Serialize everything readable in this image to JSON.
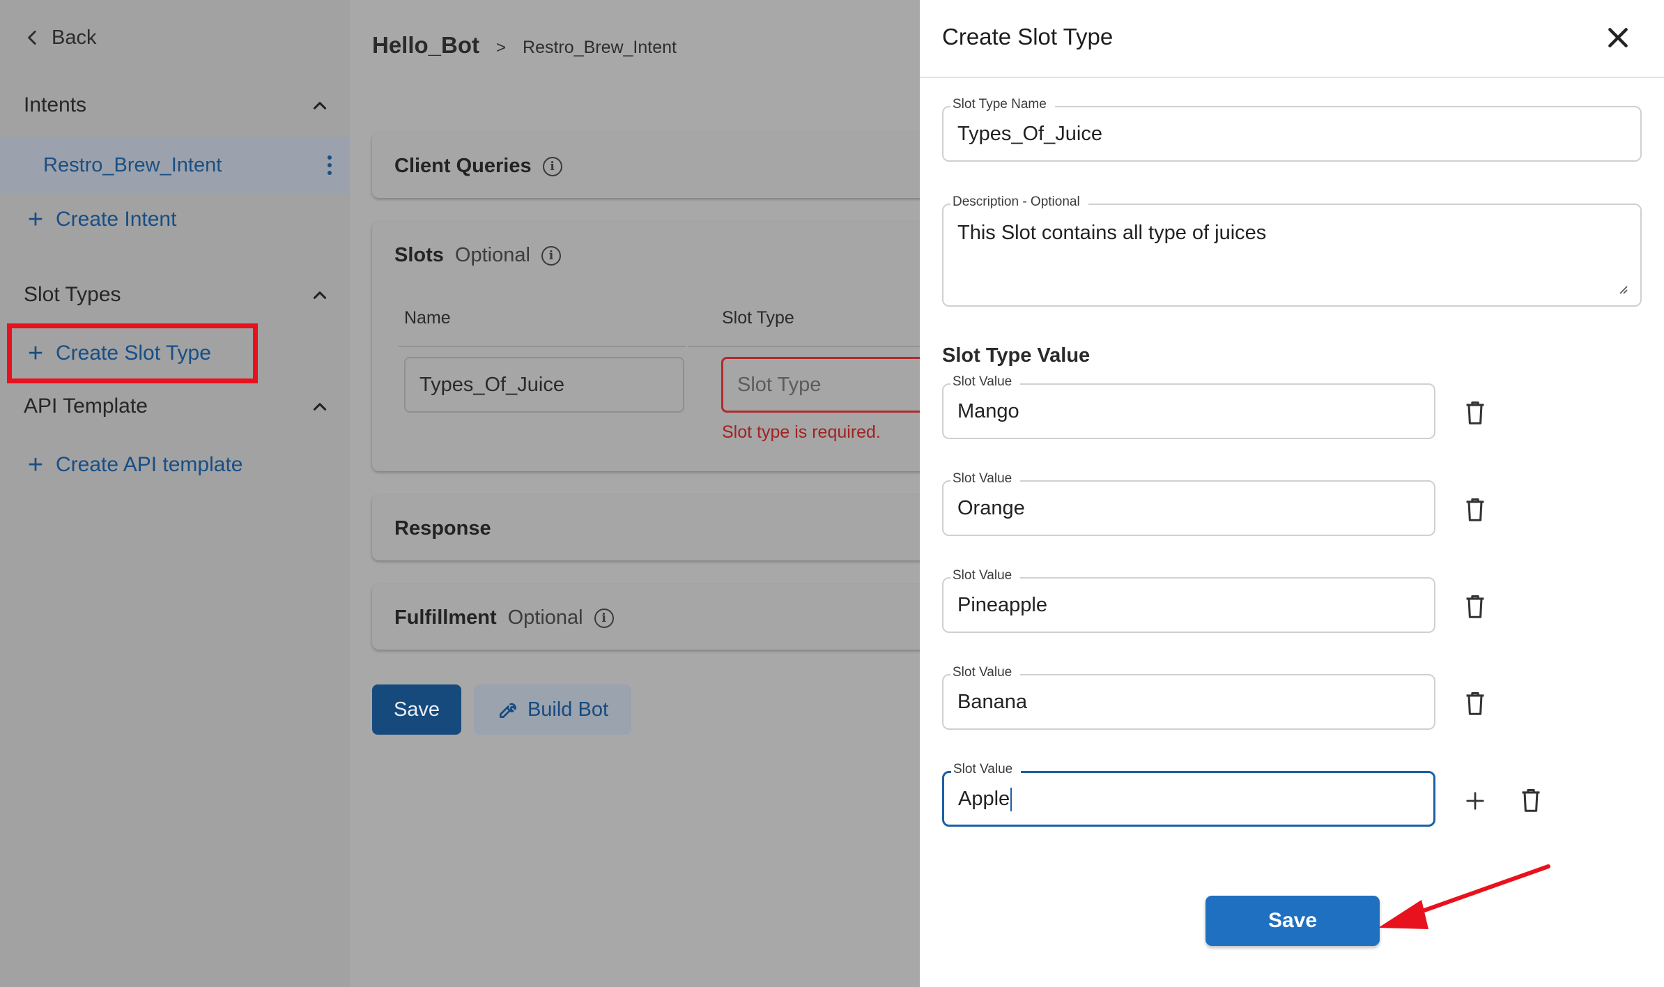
{
  "sidebar": {
    "back_label": "Back",
    "intents_label": "Intents",
    "intent_items": [
      "Restro_Brew_Intent"
    ],
    "create_intent_label": "Create Intent",
    "slot_types_label": "Slot Types",
    "create_slot_type_label": "Create Slot Type",
    "api_template_label": "API Template",
    "create_api_template_label": "Create API template"
  },
  "breadcrumb": {
    "bot": "Hello_Bot",
    "separator": ">",
    "intent": "Restro_Brew_Intent"
  },
  "main": {
    "client_queries": "Client Queries",
    "slots": {
      "title": "Slots",
      "optional": "Optional",
      "col_name": "Name",
      "col_slot_type": "Slot Type",
      "name_value": "Types_Of_Juice",
      "slot_type_placeholder": "Slot Type",
      "error": "Slot type is required."
    },
    "response": "Response",
    "fulfillment": {
      "title": "Fulfillment",
      "optional": "Optional"
    },
    "save_label": "Save",
    "build_label": "Build Bot"
  },
  "drawer": {
    "title": "Create Slot Type",
    "slot_type_name_label": "Slot Type Name",
    "slot_type_name_value": "Types_Of_Juice",
    "description_label": "Description - Optional",
    "description_value": "This Slot contains all type of juices",
    "slot_type_value_title": "Slot Type Value",
    "slot_value_label": "Slot Value",
    "slot_values": [
      "Mango",
      "Orange",
      "Pineapple",
      "Banana",
      "Apple"
    ],
    "save_label": "Save"
  },
  "colors": {
    "highlight": "#e8121e",
    "primary": "#1f70c1",
    "error": "#a22222",
    "annotation_arrow": "#e8121e"
  }
}
